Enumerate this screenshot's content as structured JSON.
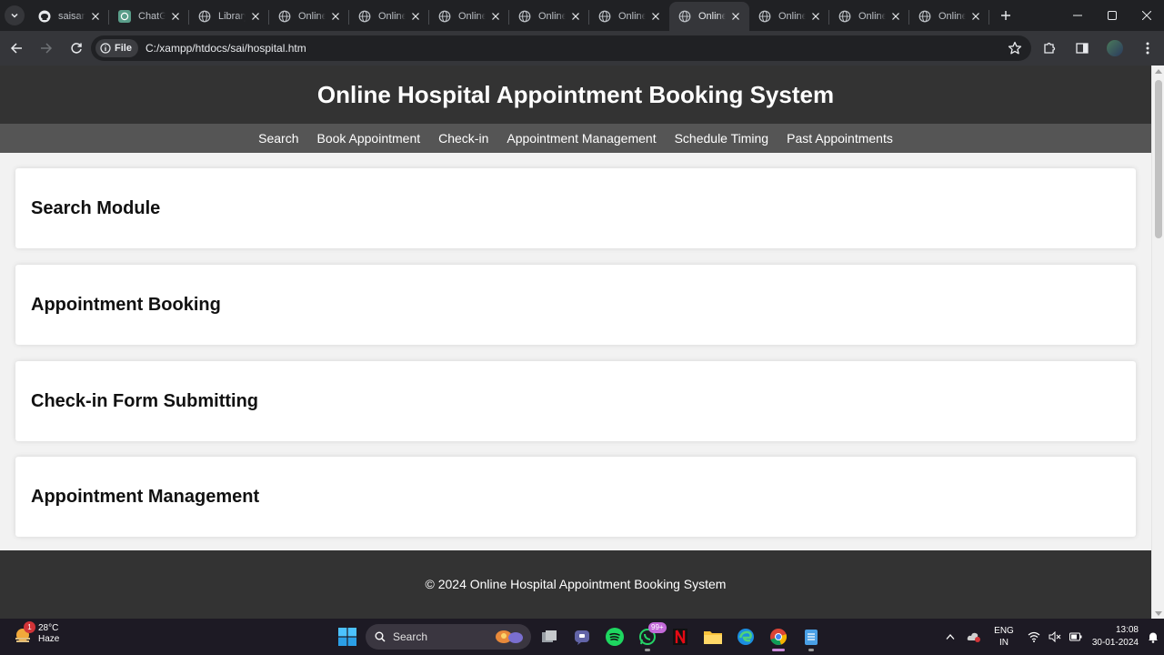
{
  "browser": {
    "tabs": [
      {
        "title": "saisant",
        "icon": "github-icon",
        "active": false
      },
      {
        "title": "ChatGPT",
        "icon": "chatgpt-icon",
        "active": false
      },
      {
        "title": "Library",
        "icon": "globe-icon",
        "active": false
      },
      {
        "title": "Online",
        "icon": "globe-icon",
        "active": false
      },
      {
        "title": "Online",
        "icon": "globe-icon",
        "active": false
      },
      {
        "title": "Online",
        "icon": "globe-icon",
        "active": false
      },
      {
        "title": "Online",
        "icon": "globe-icon",
        "active": false
      },
      {
        "title": "Online",
        "icon": "globe-icon",
        "active": false
      },
      {
        "title": "Online",
        "icon": "globe-icon",
        "active": true
      },
      {
        "title": "Online",
        "icon": "globe-icon",
        "active": false
      },
      {
        "title": "Online",
        "icon": "globe-icon",
        "active": false
      },
      {
        "title": "Online",
        "icon": "globe-icon",
        "active": false
      }
    ],
    "address": {
      "chip_label": "File",
      "url": "C:/xampp/htdocs/sai/hospital.htm"
    }
  },
  "page": {
    "header_title": "Online Hospital Appointment Booking System",
    "nav": [
      "Search",
      "Book Appointment",
      "Check-in",
      "Appointment Management",
      "Schedule Timing",
      "Past Appointments"
    ],
    "sections": [
      "Search Module",
      "Appointment Booking",
      "Check-in Form Submitting",
      "Appointment Management"
    ],
    "footer": "© 2024 Online Hospital Appointment Booking System"
  },
  "taskbar": {
    "weather_temp": "28°C",
    "weather_desc": "Haze",
    "weather_badge": "1",
    "search_label": "Search",
    "whatsapp_badge": "99+",
    "lang_line1": "ENG",
    "lang_line2": "IN",
    "time": "13:08",
    "date": "30-01-2024"
  },
  "colors": {
    "header_bg": "#333333",
    "nav_bg": "#555555",
    "page_bg": "#f2f2f2",
    "card_bg": "#ffffff"
  }
}
